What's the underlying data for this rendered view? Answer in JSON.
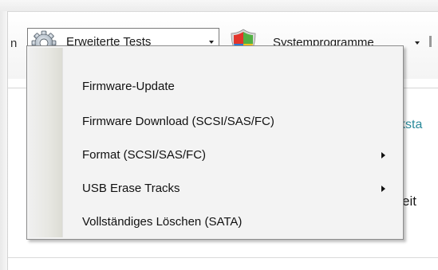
{
  "toolbar": {
    "partial_left_text": "n",
    "advanced_tests": {
      "label": "Erweiterte Tests",
      "icon": "gear-icon"
    },
    "system_programs": {
      "label": "Systemprogramme",
      "icon": "windows-shield-icon"
    }
  },
  "background": {
    "partial_teal_text": "ksta",
    "partial_text": "eit"
  },
  "menu": {
    "items": [
      {
        "label": "Firmware-Update",
        "has_submenu": false
      },
      {
        "label": "Firmware Download (SCSI/SAS/FC)",
        "has_submenu": false
      },
      {
        "label": "Format (SCSI/SAS/FC)",
        "has_submenu": true
      },
      {
        "label": "USB Erase Tracks",
        "has_submenu": true
      },
      {
        "label": "Vollständiges Löschen (SATA)",
        "has_submenu": false
      }
    ]
  },
  "colors": {
    "teal_text": "#2a8a9a",
    "menu_background": "#f3f3f3",
    "menu_border": "#8c8c8c"
  }
}
